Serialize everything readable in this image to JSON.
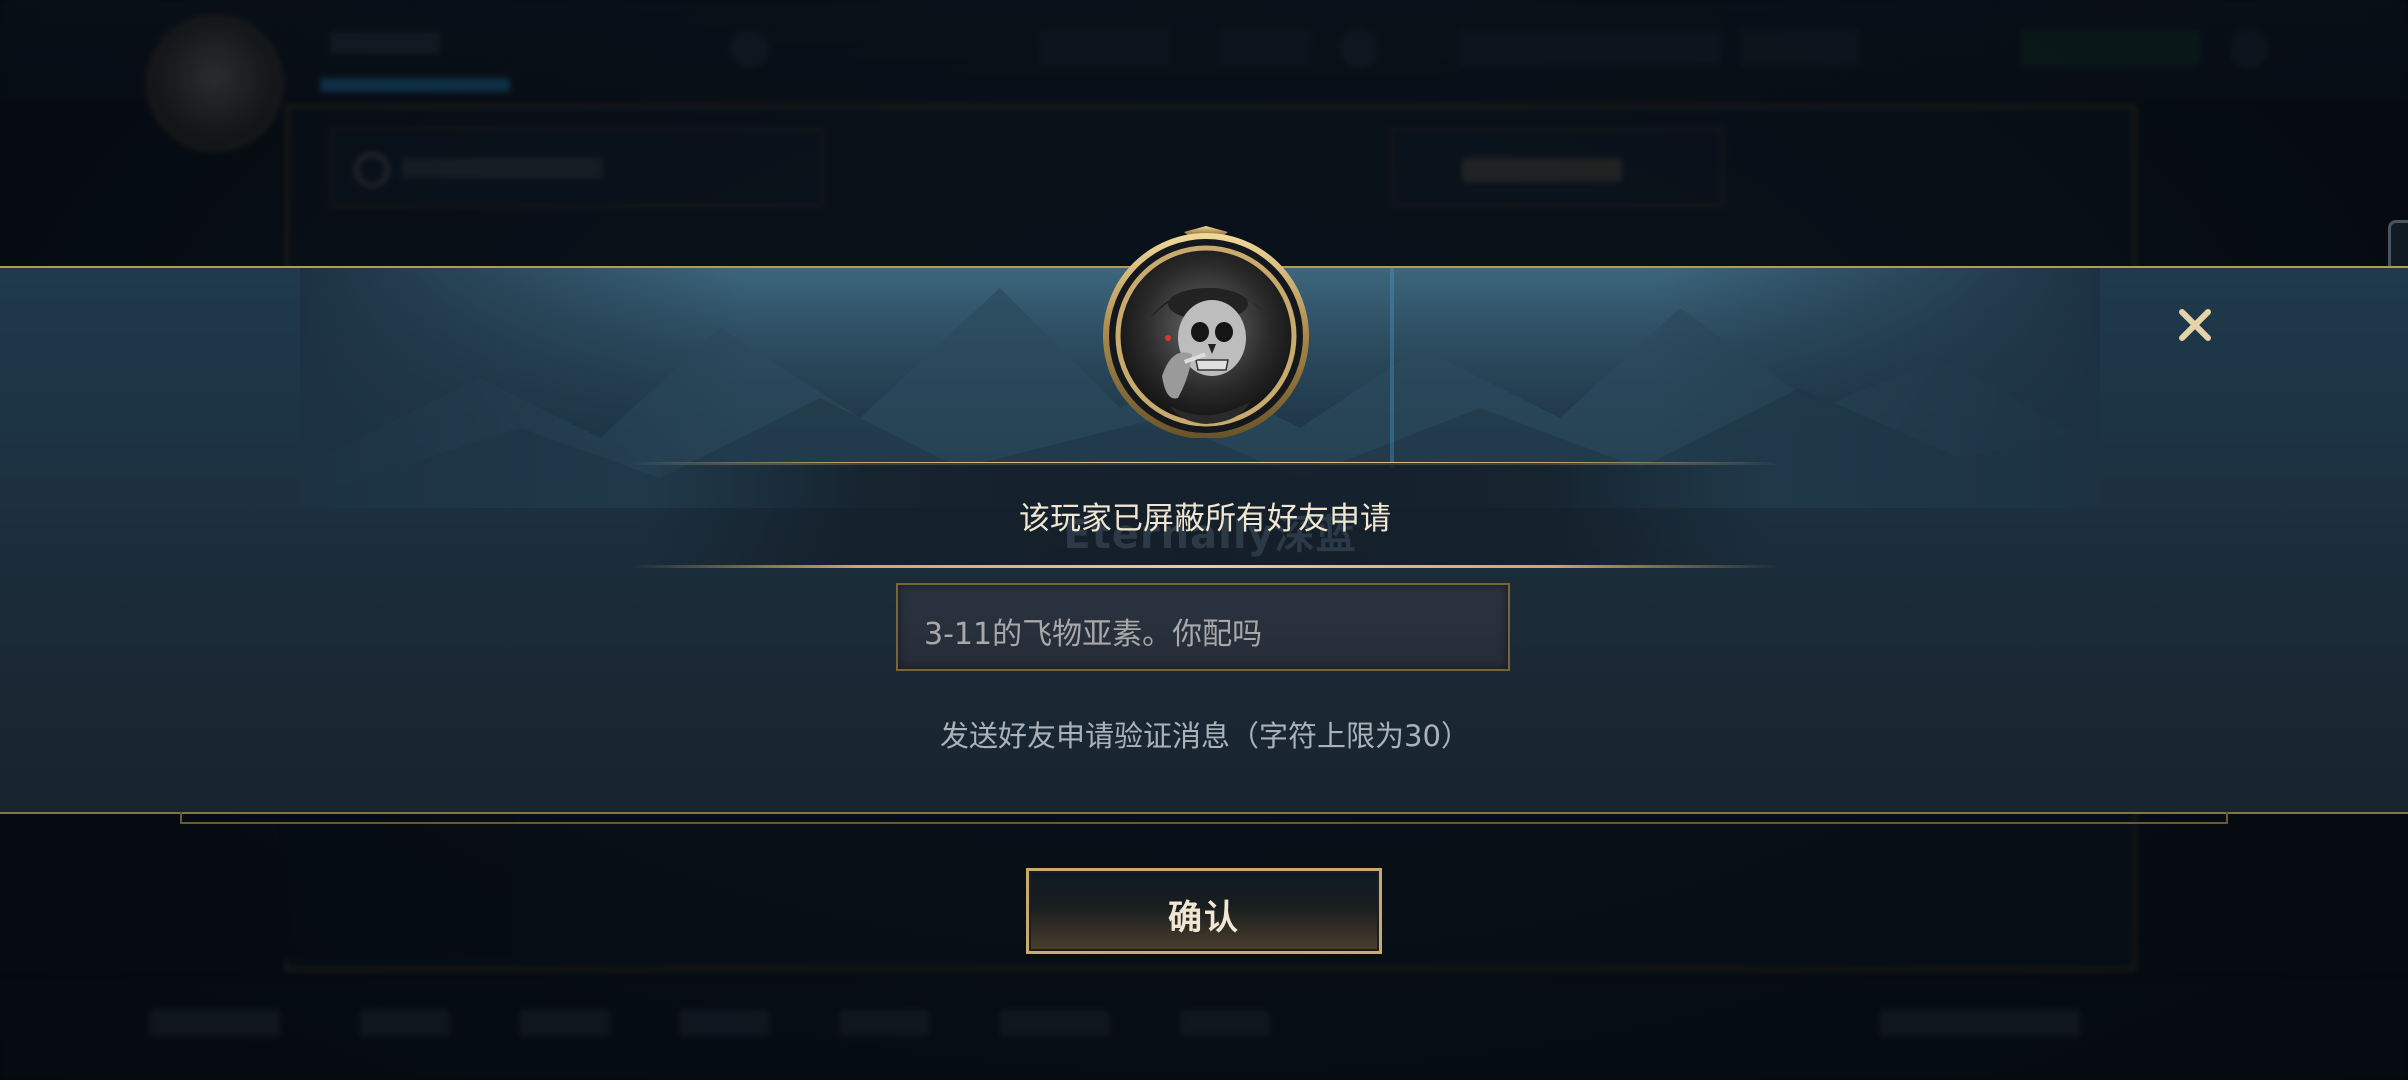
{
  "dialog": {
    "title": "该玩家已屏蔽所有好友申请",
    "background_name": "Eternally深蓝",
    "message_value": "3-11的飞物亚素。你配吗",
    "hint": "发送好友申请验证消息（字符上限为30）",
    "confirm_label": "确认",
    "close_icon": "close-icon",
    "portrait_icon": "player-portrait-skull"
  },
  "colors": {
    "gold": "#c8aa6e",
    "text_light": "#f0e6d2",
    "band": "#1c3242"
  }
}
